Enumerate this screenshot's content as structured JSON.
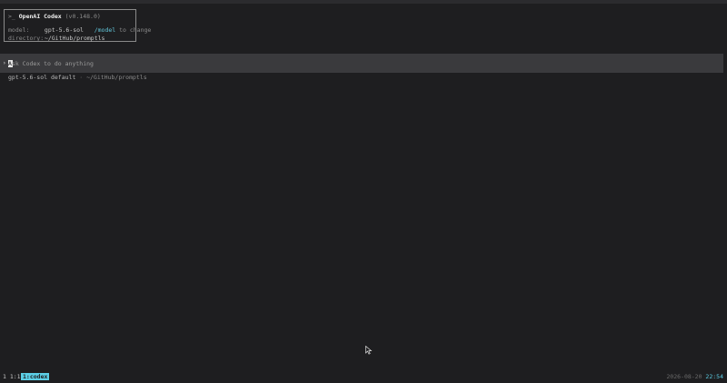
{
  "header": {
    "prompt_symbol": ">_",
    "app_name": "OpenAI Codex",
    "version": "(v0.148.0)",
    "model_key": "model:",
    "model_value": "gpt-5.6-sol",
    "model_cmd": "/model",
    "model_hint": " to change",
    "directory_key": "directory:",
    "directory_value": "~/GitHub/promptls"
  },
  "prompt": {
    "arrow": "›",
    "first_char": "A",
    "placeholder": "sk Codex to do anything"
  },
  "status": {
    "model": "gpt-5.6-sol default",
    "separator": " · ",
    "directory": "~/GitHub/promptls"
  },
  "tmux": {
    "session": "1 1:1",
    "window": "1:codex",
    "date": "2026-08-20 ",
    "time": "22:54"
  },
  "colors": {
    "background": "#1e1e20",
    "prompt_bar": "#3a3a3d",
    "accent_cyan": "#5ccfe6",
    "border": "#8a8a8a"
  },
  "icons": {
    "mouse_pointer": "arrow-cursor-icon"
  }
}
